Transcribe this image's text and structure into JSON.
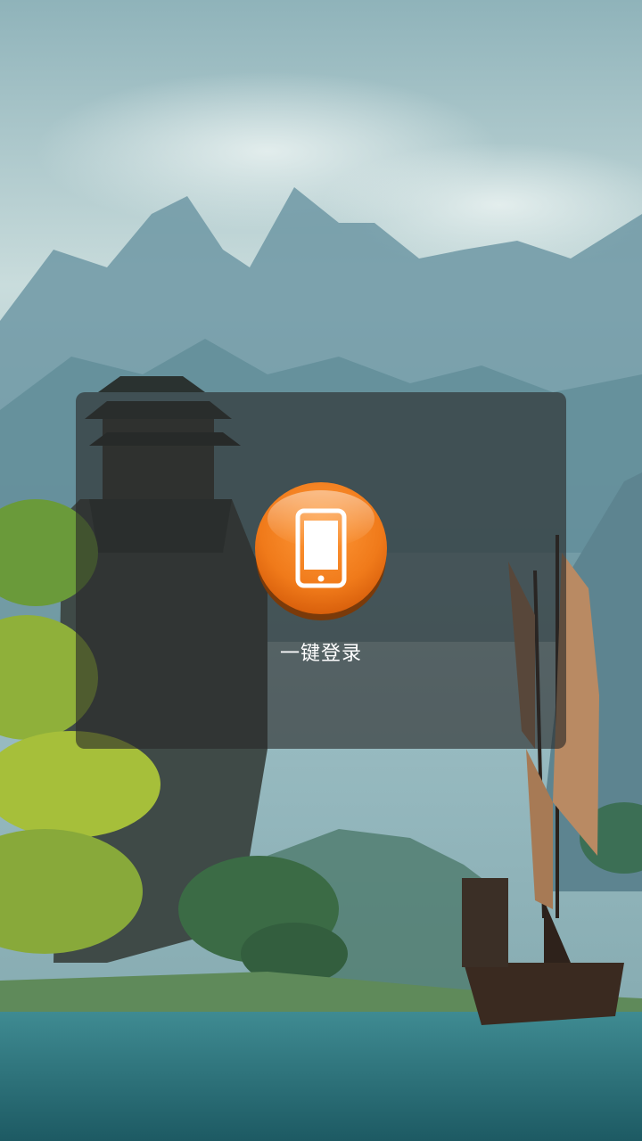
{
  "login": {
    "button_label": "一键登录",
    "icon": "phone-icon",
    "accent_color": "#f07a1a"
  }
}
